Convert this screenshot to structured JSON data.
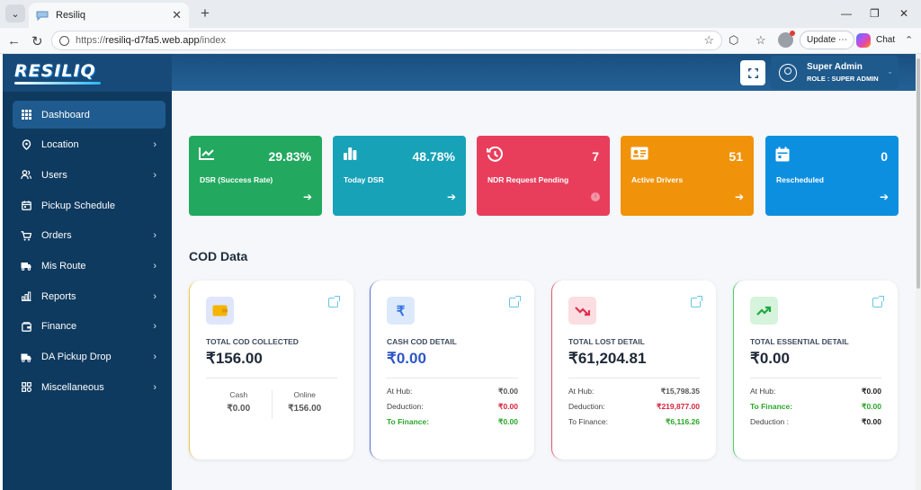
{
  "browser": {
    "tab_title": "Resiliq",
    "url_prefix": "https://",
    "url_host": "resiliq-d7fa5.web.app",
    "url_path": "/index",
    "update_label": "Update",
    "chat_label": "Chat"
  },
  "app": {
    "logo": "RESILIQ"
  },
  "sidebar": {
    "items": [
      {
        "label": "Dashboard",
        "icon": "grid-icon"
      },
      {
        "label": "Location",
        "icon": "location-icon"
      },
      {
        "label": "Users",
        "icon": "users-icon"
      },
      {
        "label": "Pickup Schedule",
        "icon": "calendar-icon"
      },
      {
        "label": "Orders",
        "icon": "cart-icon"
      },
      {
        "label": "Mis Route",
        "icon": "route-icon"
      },
      {
        "label": "Reports",
        "icon": "chart-icon"
      },
      {
        "label": "Finance",
        "icon": "wallet-icon"
      },
      {
        "label": "DA Pickup Drop",
        "icon": "truck-icon"
      },
      {
        "label": "Miscellaneous",
        "icon": "apps-icon"
      }
    ]
  },
  "header": {
    "user_name": "Super Admin",
    "user_role": "ROLE : SUPER ADMIN"
  },
  "stats": [
    {
      "value": "29.83%",
      "label": "DSR (Success Rate)",
      "color": "#22a95f"
    },
    {
      "value": "48.78%",
      "label": "Today DSR",
      "color": "#17a2b8"
    },
    {
      "value": "7",
      "label": "NDR Request Pending",
      "color": "#e83e5c"
    },
    {
      "value": "51",
      "label": "Active Drivers",
      "color": "#f0930b"
    },
    {
      "value": "0",
      "label": "Rescheduled",
      "color": "#0d8fe0"
    }
  ],
  "cod": {
    "title": "COD Data",
    "cards": [
      {
        "label": "TOTAL COD COLLECTED",
        "amount": "₹156.00",
        "cash_label": "Cash",
        "cash_value": "₹0.00",
        "online_label": "Online",
        "online_value": "₹156.00"
      },
      {
        "label": "CASH COD DETAIL",
        "amount": "₹0.00",
        "rows": [
          {
            "k": "At Hub:",
            "v": "₹0.00"
          },
          {
            "k": "Deduction:",
            "v": "₹0.00"
          },
          {
            "k": "To Finance:",
            "v": "₹0.00"
          }
        ]
      },
      {
        "label": "TOTAL LOST DETAIL",
        "amount": "₹61,204.81",
        "rows": [
          {
            "k": "At Hub:",
            "v": "₹15,798.35"
          },
          {
            "k": "Deduction:",
            "v": "₹219,877.00"
          },
          {
            "k": "To Finance:",
            "v": "₹6,116.26"
          }
        ]
      },
      {
        "label": "TOTAL ESSENTIAL DETAIL",
        "amount": "₹0.00",
        "rows": [
          {
            "k": "At Hub:",
            "v": "₹0.00"
          },
          {
            "k": "To Finance:",
            "v": "₹0.00"
          },
          {
            "k": "Deduction :",
            "v": "₹0.00"
          }
        ]
      }
    ]
  }
}
